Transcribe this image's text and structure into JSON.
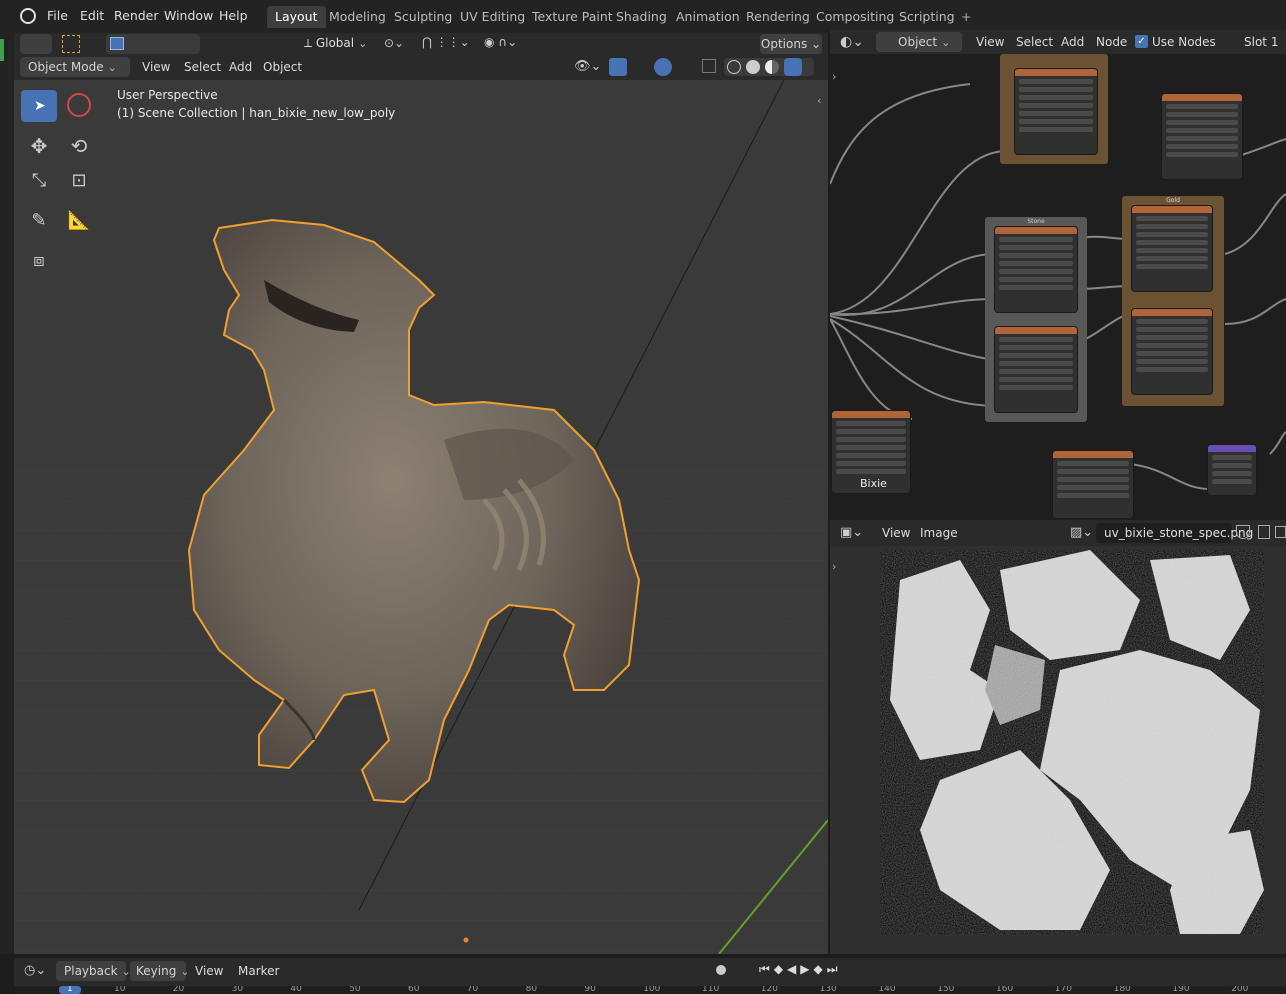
{
  "menubar": {
    "items": [
      "File",
      "Edit",
      "Render",
      "Window",
      "Help"
    ],
    "workspaces": [
      "Layout",
      "Modeling",
      "Sculpting",
      "UV Editing",
      "Texture Paint",
      "Shading",
      "Animation",
      "Rendering",
      "Compositing",
      "Scripting"
    ],
    "active_workspace": "Layout",
    "add_tab": "+"
  },
  "tool_header": {
    "transform_orientation": "Global",
    "options": "Options"
  },
  "viewport_header": {
    "mode": "Object Mode",
    "menus": [
      "View",
      "Select",
      "Add",
      "Object"
    ]
  },
  "viewport": {
    "perspective_label": "User Perspective",
    "collection_label": "(1) Scene Collection | han_bixie_new_low_poly"
  },
  "node_editor_header": {
    "object_type": "Object",
    "menus": [
      "View",
      "Select",
      "Add",
      "Node"
    ],
    "use_nodes_label": "Use Nodes",
    "use_nodes_checked": true,
    "slot": "Slot 1"
  },
  "node_editor": {
    "frames": [
      "Stone",
      "Gold",
      "Bixie"
    ]
  },
  "image_editor_header": {
    "menus": [
      "View",
      "Image"
    ],
    "image_name": "uv_bixie_stone_spec.png"
  },
  "timeline_header": {
    "menus": [
      "Playback",
      "Keying",
      "View",
      "Marker"
    ],
    "frame_numbers": [
      "1",
      "10",
      "20",
      "30",
      "40",
      "50",
      "60",
      "70",
      "80",
      "90",
      "100",
      "110",
      "120",
      "130",
      "140",
      "150",
      "160",
      "170",
      "180",
      "190",
      "200"
    ]
  },
  "colors": {
    "accent": "#4772b3",
    "selection_outline": "#f0a030",
    "node_image_header": "#b0643a",
    "frame_gold": "#7a5a30",
    "frame_stone": "#585858"
  }
}
